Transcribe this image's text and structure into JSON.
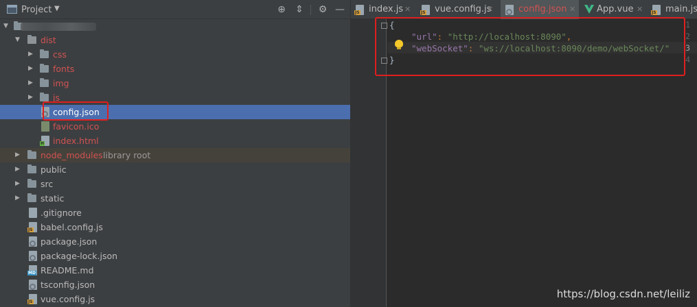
{
  "project_panel": {
    "title": "Project",
    "tree": [
      {
        "label": "",
        "type": "root",
        "expanded": true
      },
      {
        "label": "dist",
        "type": "folder",
        "expanded": true,
        "color": "#d25252"
      },
      {
        "label": "css",
        "type": "folder",
        "expanded": false,
        "color": "#d25252"
      },
      {
        "label": "fonts",
        "type": "folder",
        "expanded": false,
        "color": "#d25252"
      },
      {
        "label": "img",
        "type": "folder",
        "expanded": false,
        "color": "#d25252"
      },
      {
        "label": "js",
        "type": "folder",
        "expanded": false,
        "color": "#d25252"
      },
      {
        "label": "config.json",
        "type": "file",
        "selected": true
      },
      {
        "label": "favicon.ico",
        "type": "file",
        "color": "#d25252"
      },
      {
        "label": "index.html",
        "type": "file",
        "color": "#d25252"
      },
      {
        "label": "node_modules",
        "extra": "library root",
        "type": "folder",
        "expanded": false,
        "color": "#d25252"
      },
      {
        "label": "public",
        "type": "folder",
        "expanded": false
      },
      {
        "label": "src",
        "type": "folder",
        "expanded": false
      },
      {
        "label": "static",
        "type": "folder",
        "expanded": false
      },
      {
        "label": ".gitignore",
        "type": "file"
      },
      {
        "label": "babel.config.js",
        "type": "file"
      },
      {
        "label": "package.json",
        "type": "file"
      },
      {
        "label": "package-lock.json",
        "type": "file"
      },
      {
        "label": "README.md",
        "type": "file"
      },
      {
        "label": "tsconfig.json",
        "type": "file"
      },
      {
        "label": "vue.config.js",
        "type": "file"
      }
    ]
  },
  "editor": {
    "tabs": [
      {
        "label": "index.js",
        "active": false
      },
      {
        "label": "vue.config.js",
        "active": false
      },
      {
        "label": "config.json",
        "active": true
      },
      {
        "label": "App.vue",
        "active": false
      },
      {
        "label": "main.js",
        "active": false
      }
    ],
    "line_numbers": [
      "1",
      "2",
      "3",
      "4"
    ],
    "code": {
      "line1": "{",
      "line2_key": "\"url\"",
      "line2_colon": ": ",
      "line2_value": "\"http://localhost:8090\"",
      "line2_comma": ",",
      "line3_key": "\"webSocket\"",
      "line3_colon": ": ",
      "line3_value": "\"ws://localhost:8090/demo/webSocket/\"",
      "line4": "}"
    }
  },
  "watermark": "https://blog.csdn.net/leiliz"
}
